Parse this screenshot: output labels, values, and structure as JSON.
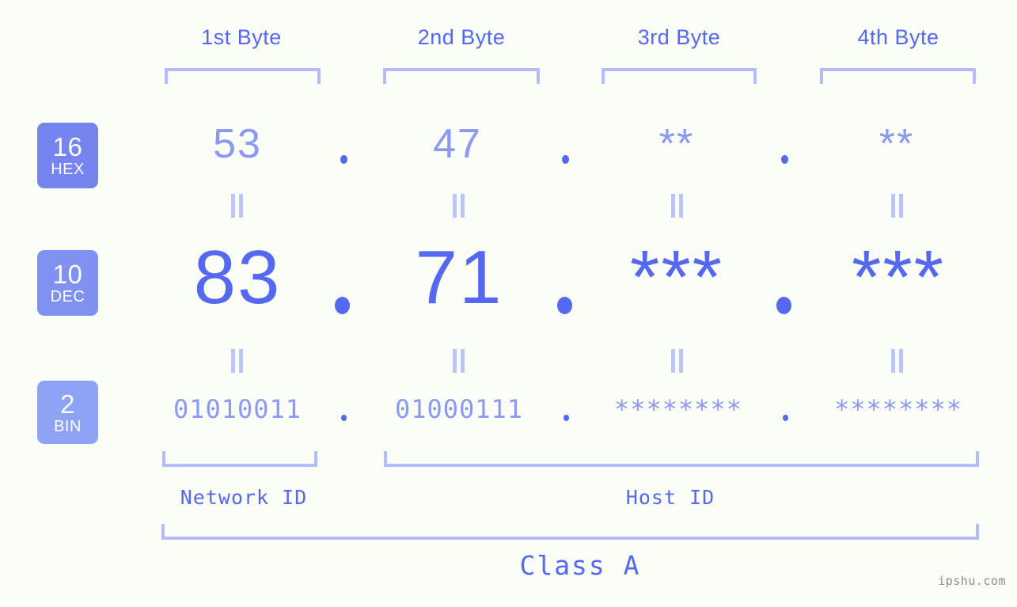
{
  "page": {
    "background_color": "#fbfdf7",
    "accent_color": "#5468f0",
    "accent_light_color": "#8a9af2",
    "bracket_color": "#b3bdfa"
  },
  "byte_headers": [
    {
      "label": "1st Byte"
    },
    {
      "label": "2nd Byte"
    },
    {
      "label": "3rd Byte"
    },
    {
      "label": "4th Byte"
    }
  ],
  "rows": [
    {
      "badge": {
        "base": "16",
        "name": "HEX",
        "color": "#7584ef"
      },
      "values": [
        "53",
        "47",
        "**",
        "**"
      ],
      "separator": "."
    },
    {
      "badge": {
        "base": "10",
        "name": "DEC",
        "color": "#8091f2"
      },
      "values": [
        "83",
        "71",
        "***",
        "***"
      ],
      "separator": "."
    },
    {
      "badge": {
        "base": "2",
        "name": "BIN",
        "color": "#8ea2f6"
      },
      "values": [
        "01010011",
        "01000111",
        "********",
        "********"
      ],
      "separator": "."
    }
  ],
  "equals_symbol": "||",
  "id_sections": [
    {
      "label": "Network ID"
    },
    {
      "label": "Host ID"
    }
  ],
  "class_label": "Class A",
  "watermark": "ipshu.com"
}
